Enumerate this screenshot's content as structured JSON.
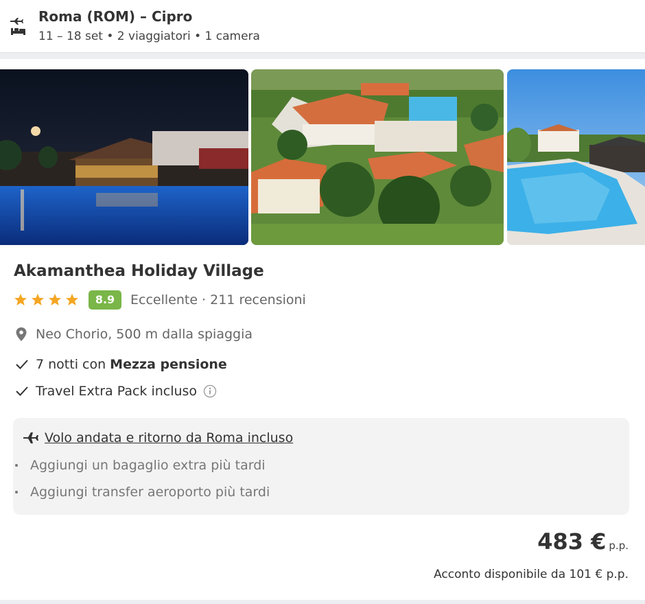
{
  "summary": {
    "route": "Roma (ROM) – Cipro",
    "meta": "11 – 18 set • 2 viaggiatori • 1 camera",
    "icon": "flight-hotel-icon"
  },
  "hotel": {
    "name": "Akamanthea Holiday Village",
    "stars": 4,
    "score": "8.9",
    "score_color": "#7ab648",
    "rating_text": "Eccellente · 211 recensioni",
    "location": "Neo Chorio, 500 m dalla spiaggia",
    "photos": [
      "pool-bar-night",
      "aerial-resort-view",
      "pool-daytime"
    ]
  },
  "features": {
    "nights_prefix": "7 notti con",
    "nights_board": "Mezza pensione",
    "extra_pack": "Travel Extra Pack incluso"
  },
  "flight": {
    "link_text": "Volo andata e ritorno da Roma incluso",
    "addons": [
      "Aggiungi un bagaglio extra più tardi",
      "Aggiungi transfer aeroporto più tardi"
    ]
  },
  "pricing": {
    "price": "483 €",
    "unit": "p.p.",
    "deposit": "Acconto disponibile da 101 € p.p."
  },
  "colors": {
    "star": "#f5a623",
    "accent_green": "#7ab648",
    "text_dark": "#333333",
    "text_muted": "#666666"
  }
}
